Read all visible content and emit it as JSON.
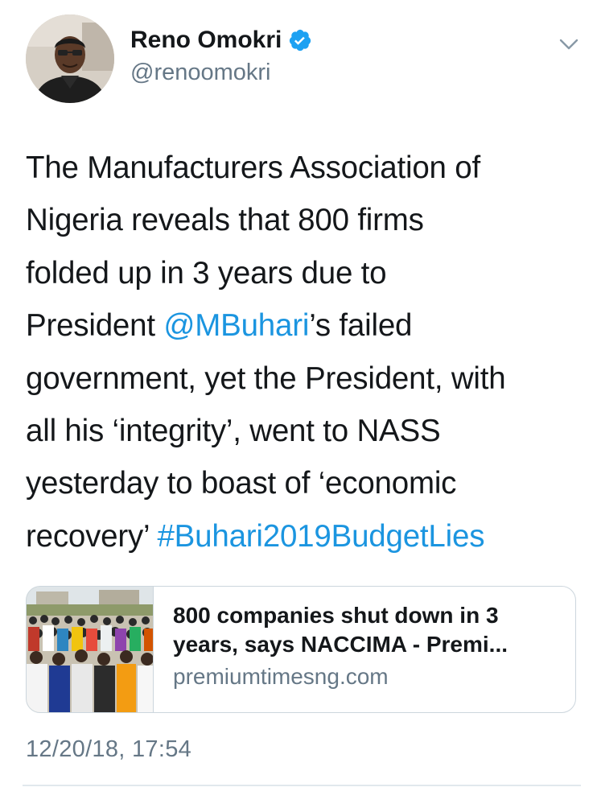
{
  "author": {
    "display_name": "Reno Omokri",
    "handle": "@renoomokri",
    "verified": true
  },
  "tweet": {
    "lines": [
      [
        "The Manufacturers Association of"
      ],
      [
        "Nigeria reveals that 800 firms"
      ],
      [
        "folded up in 3 years due to"
      ],
      [
        "President ",
        "@MBuhari",
        "’s failed"
      ],
      [
        "government, yet the President, with"
      ],
      [
        "all his ‘integrity’, went to NASS"
      ],
      [
        "yesterday to boast of ‘economic"
      ],
      [
        "recovery’ ",
        "#Buhari2019BudgetLies"
      ]
    ],
    "mention": "@MBuhari",
    "hashtag": "#Buhari2019BudgetLies"
  },
  "card": {
    "title_line1": "800 companies shut down in 3",
    "title_line2": "years, says NACCIMA - Premi...",
    "domain": "premiumtimesng.com"
  },
  "timestamp": "12/20/18, 17:54",
  "colors": {
    "link": "#1b95e0",
    "verified": "#1da1f2",
    "secondary_text": "#657786",
    "border": "#ccd6dd"
  },
  "icons": {
    "verified": "verified-badge-icon",
    "caret": "chevron-down-icon"
  }
}
